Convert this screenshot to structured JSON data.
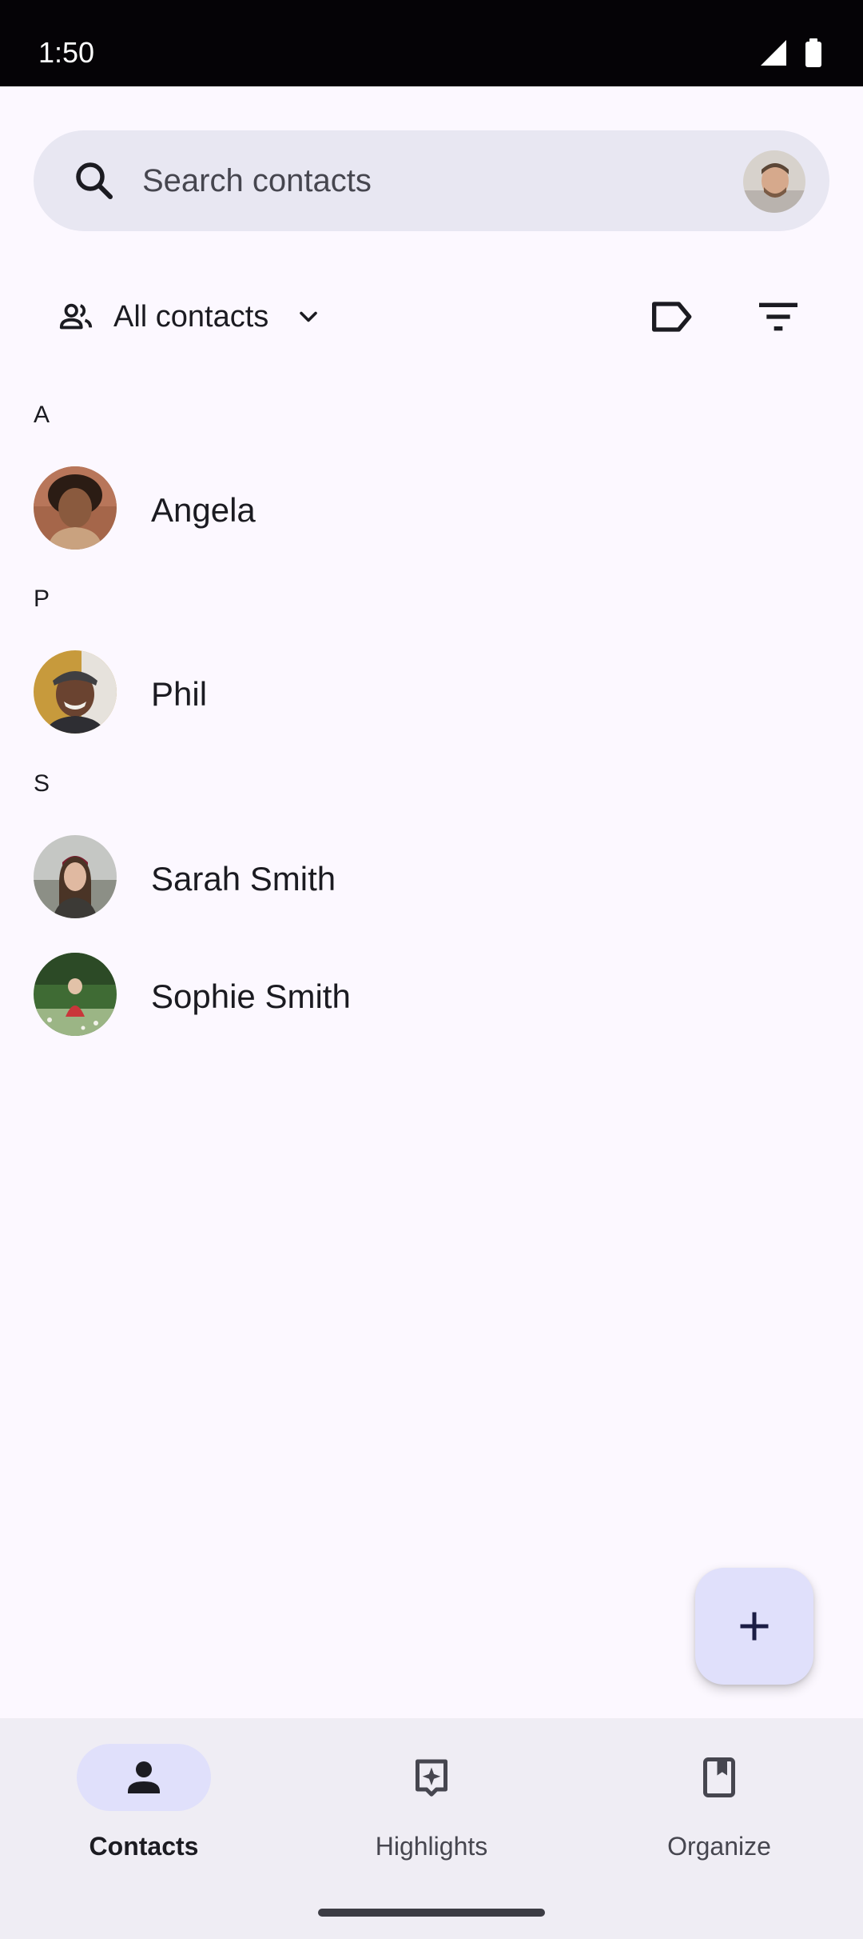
{
  "status_bar": {
    "time": "1:50",
    "icons": [
      "signal-icon",
      "battery-icon"
    ]
  },
  "search": {
    "placeholder": "Search contacts",
    "icon": "search-icon",
    "account_avatar": "account-avatar"
  },
  "filter": {
    "label": "All contacts",
    "icons": [
      "people-icon",
      "chevron-down-icon",
      "label-icon",
      "sort-icon"
    ]
  },
  "sections": [
    {
      "letter": "A",
      "contacts": [
        {
          "name": "Angela"
        }
      ]
    },
    {
      "letter": "P",
      "contacts": [
        {
          "name": "Phil"
        }
      ]
    },
    {
      "letter": "S",
      "contacts": [
        {
          "name": "Sarah Smith"
        },
        {
          "name": "Sophie Smith"
        }
      ]
    }
  ],
  "fab": {
    "icon": "add-icon"
  },
  "nav": {
    "items": [
      {
        "label": "Contacts",
        "icon": "person-icon",
        "active": true
      },
      {
        "label": "Highlights",
        "icon": "highlights-icon",
        "active": false
      },
      {
        "label": "Organize",
        "icon": "bookmark-icon",
        "active": false
      }
    ]
  },
  "colors": {
    "background": "#fcf8ff",
    "search_bg": "#e8e7f2",
    "accent_container": "#e0e0fb",
    "nav_bg": "#efedf4"
  }
}
